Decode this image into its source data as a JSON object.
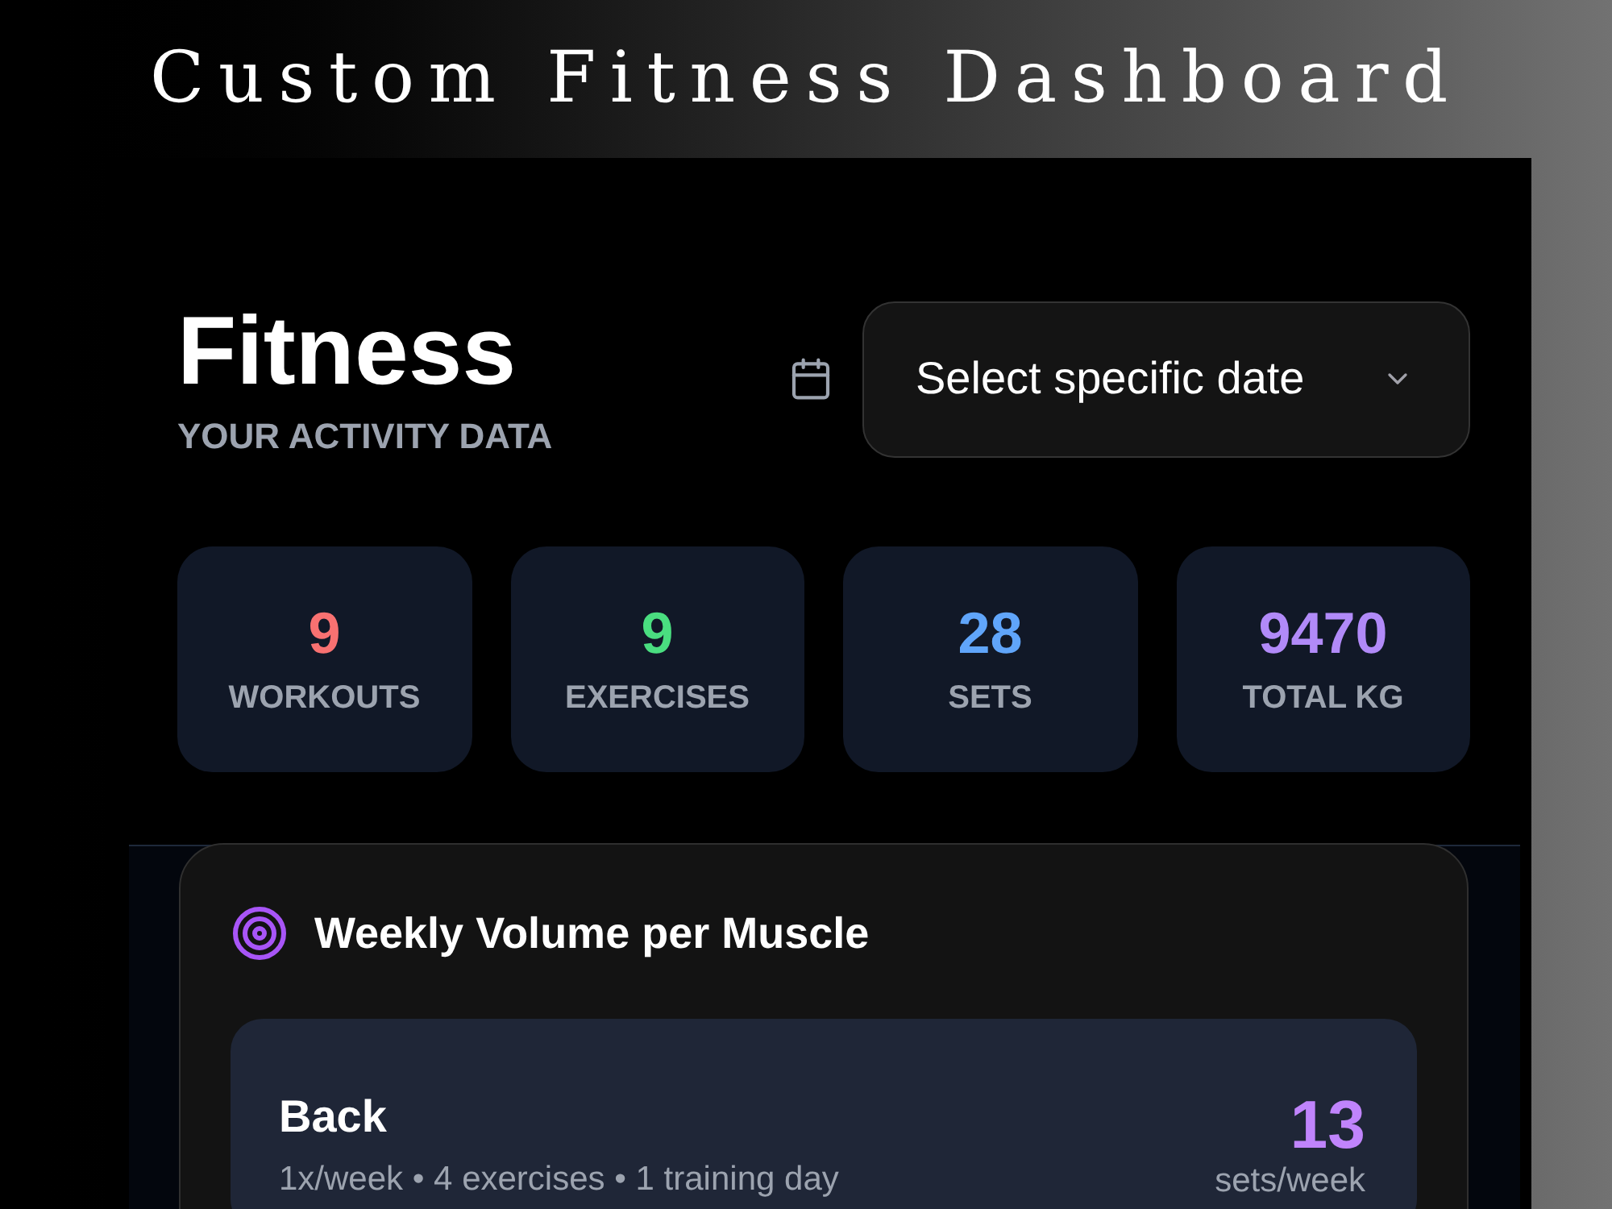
{
  "title": "Custom Fitness Dashboard",
  "header": {
    "title": "Fitness",
    "subtitle": "YOUR ACTIVITY DATA",
    "date_select": {
      "label": "Select specific date"
    }
  },
  "stats": [
    {
      "value": "9",
      "label": "WORKOUTS",
      "color": "#f87171"
    },
    {
      "value": "9",
      "label": "EXERCISES",
      "color": "#4ade80"
    },
    {
      "value": "28",
      "label": "SETS",
      "color": "#60a5fa"
    },
    {
      "value": "9470",
      "label": "TOTAL KG",
      "color": "#b18af8"
    }
  ],
  "weekly_volume": {
    "title": "Weekly Volume per Muscle",
    "muscles": [
      {
        "name": "Back",
        "details": "1x/week • 4 exercises • 1 training day",
        "sets": "13",
        "unit": "sets/week"
      }
    ]
  }
}
